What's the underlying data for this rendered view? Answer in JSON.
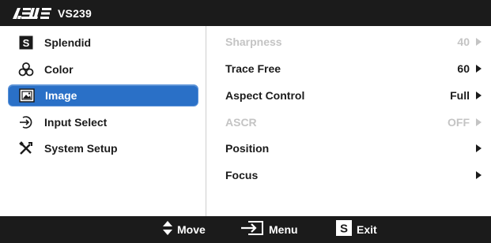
{
  "header": {
    "brand": "ASUS",
    "model": "VS239"
  },
  "menu": {
    "items": [
      {
        "label": "Splendid",
        "icon": "splendid-s-icon"
      },
      {
        "label": "Color",
        "icon": "color-icon"
      },
      {
        "label": "Image",
        "icon": "image-icon",
        "selected": true
      },
      {
        "label": "Input Select",
        "icon": "input-select-icon"
      },
      {
        "label": "System Setup",
        "icon": "system-setup-icon"
      }
    ]
  },
  "submenu": {
    "items": [
      {
        "label": "Sharpness",
        "value": "40",
        "disabled": true
      },
      {
        "label": "Trace Free",
        "value": "60",
        "disabled": false
      },
      {
        "label": "Aspect Control",
        "value": "Full",
        "disabled": false
      },
      {
        "label": "ASCR",
        "value": "OFF",
        "disabled": true
      },
      {
        "label": "Position",
        "value": "",
        "disabled": false
      },
      {
        "label": "Focus",
        "value": "",
        "disabled": false
      }
    ]
  },
  "footer": {
    "move_label": "Move",
    "menu_label": "Menu",
    "exit_label": "Exit",
    "exit_key": "S"
  },
  "colors": {
    "bar": "#1b1b1b",
    "selected": "#2a70c7",
    "disabled_text": "#c4c4c4"
  }
}
